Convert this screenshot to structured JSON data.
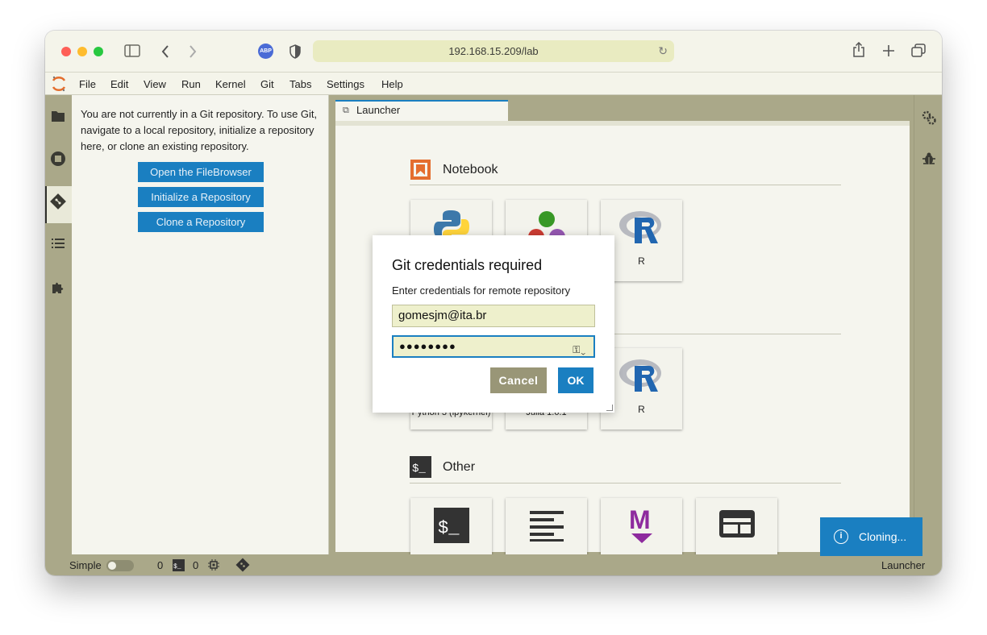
{
  "browser": {
    "url": "192.168.15.209/lab",
    "adblock_label": "ABP"
  },
  "menubar": {
    "items": [
      "File",
      "Edit",
      "View",
      "Run",
      "Kernel",
      "Git",
      "Tabs",
      "Settings",
      "Help"
    ]
  },
  "left_rail": {
    "icons": [
      "folder-icon",
      "running-icon",
      "git-icon",
      "toc-icon",
      "extension-icon"
    ]
  },
  "git_panel": {
    "message": "You are not currently in a Git repository. To use Git, navigate to a local repository, initialize a repository here, or clone an existing repository.",
    "buttons": [
      "Open the FileBrowser",
      "Initialize a Repository",
      "Clone a Repository"
    ]
  },
  "tab": {
    "label": "Launcher"
  },
  "launcher": {
    "notebook_title": "Notebook",
    "notebook_cards": [
      "",
      "",
      "R"
    ],
    "console_cards": [
      "Python 3 (ipykernel)",
      "Julia 1.6.1",
      "R"
    ],
    "other_title": "Other"
  },
  "dialog": {
    "title": "Git credentials required",
    "description": "Enter credentials for remote repository",
    "username": "gomesjm@ita.br",
    "password_mask": "●●●●●●●●",
    "cancel_label": "Cancel",
    "ok_label": "OK"
  },
  "statusbar": {
    "mode_label": "Simple",
    "kernels_count": "0",
    "terminals_count": "0",
    "right_label": "Launcher"
  },
  "toast": {
    "message": "Cloning..."
  },
  "colors": {
    "accent": "#1a7fc1",
    "chrome": "#aaa889",
    "panel": "#f5f5ee",
    "cancel": "#999677"
  }
}
